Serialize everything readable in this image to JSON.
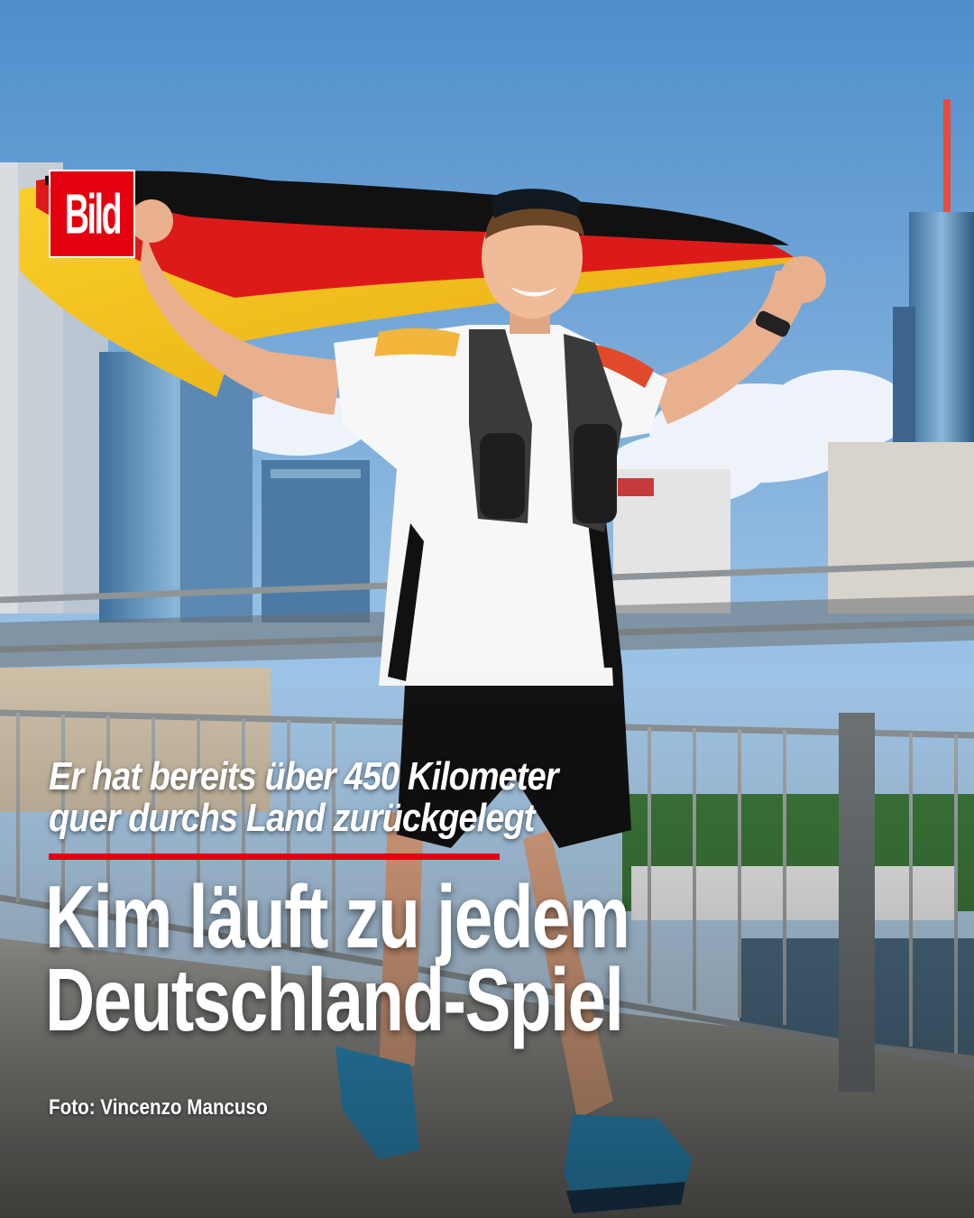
{
  "brand": {
    "logo_text": "Bild",
    "accent_color": "#e3000f"
  },
  "post": {
    "kicker_lines": [
      "Er hat bereits über 450 Kilometer",
      "quer durchs Land zurückgelegt"
    ],
    "headline_lines": [
      "Kim läuft zu jedem",
      "Deutschland-Spiel"
    ],
    "photo_credit": "Foto: Vincenzo Mancuso"
  },
  "photo": {
    "subject": "runner-with-german-flag",
    "flag_colors": [
      "#111111",
      "#dd1a1a",
      "#f5c518"
    ]
  }
}
